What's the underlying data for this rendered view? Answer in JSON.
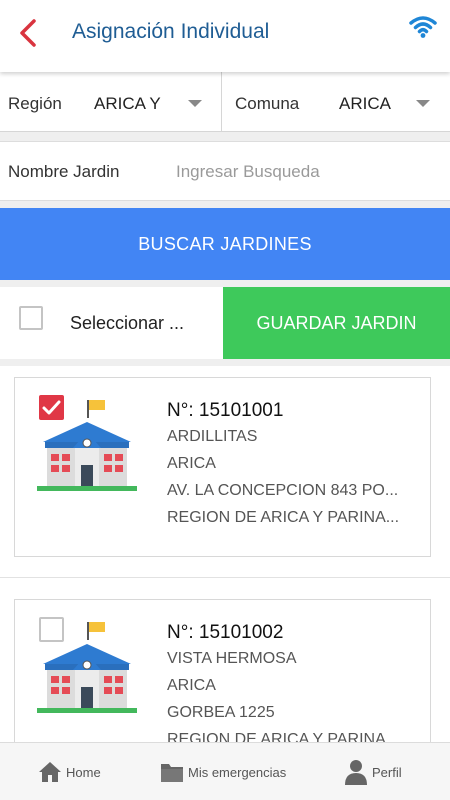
{
  "header": {
    "title": "Asignación Individual",
    "back_icon": "chevron-left-icon",
    "status_icon": "wifi-icon",
    "accent": "#d9343f",
    "title_color": "#1f5d94"
  },
  "filters": {
    "region_label": "Región",
    "region_value": "ARICA Y",
    "comuna_label": "Comuna",
    "comuna_value": "ARICA"
  },
  "search": {
    "label": "Nombre Jardin",
    "placeholder": "Ingresar Busqueda",
    "value": ""
  },
  "buttons": {
    "search": "BUSCAR JARDINES",
    "select_all": "Seleccionar ...",
    "save": "GUARDAR JARDIN",
    "search_color": "#4285f4",
    "save_color": "#3ec95b"
  },
  "gardens": [
    {
      "checked": true,
      "number": "N°: 15101001",
      "name": "ARDILLITAS",
      "comuna": "ARICA",
      "address": "AV. LA CONCEPCION 843 PO...",
      "region": "REGION DE ARICA Y PARINA..."
    },
    {
      "checked": false,
      "number": "N°: 15101002",
      "name": "VISTA HERMOSA",
      "comuna": "ARICA",
      "address": "GORBEA 1225",
      "region": "REGION DE ARICA Y PARINA..."
    }
  ],
  "nav": {
    "home": "Home",
    "emergencies": "Mis emergencias",
    "profile": "Perfil"
  }
}
